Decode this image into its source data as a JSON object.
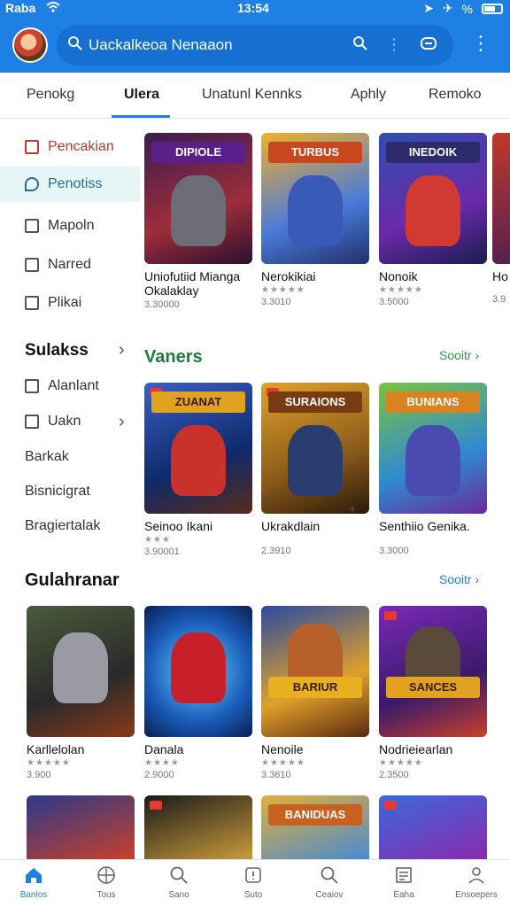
{
  "status": {
    "carrier": "Raba",
    "time": "13:54",
    "extra": "%"
  },
  "header": {
    "search_text": "Uackalkeoa Nenaaon",
    "brand": "#1f80e4"
  },
  "tabs": [
    {
      "label": "Penokg",
      "active": false
    },
    {
      "label": "Ulera",
      "active": true
    },
    {
      "label": "Unatunl Kennks",
      "active": false
    },
    {
      "label": "Aphly",
      "active": false
    },
    {
      "label": "Remoko",
      "active": false
    }
  ],
  "sidebar": {
    "items": [
      {
        "label": "Pencakian",
        "icon": "grid-icon"
      },
      {
        "label": "Penotiss",
        "icon": "chat-icon"
      },
      {
        "label": "Mapoln",
        "icon": "map-icon"
      },
      {
        "label": "Narred",
        "icon": "folder-icon"
      },
      {
        "label": "Plikai",
        "icon": "apps-icon"
      }
    ],
    "section": "Sulakss",
    "subitems": [
      {
        "label": "Alanlant",
        "icon": "tag-icon"
      },
      {
        "label": "Uakn",
        "icon": "house-icon"
      }
    ],
    "texts": [
      "Barkak",
      "Bisnicigrat",
      "Bragiertalak"
    ]
  },
  "row1": {
    "cards": [
      {
        "title": "Uniofutiid Mianga Okalaklay",
        "stars": "★★★★★",
        "meta": "3.30000",
        "art_title": "DIPIOLE"
      },
      {
        "title": "Nerokikiai",
        "stars": "★★★★★",
        "meta": "3.3010",
        "art_title": "TURBUS"
      },
      {
        "title": "Nonoik",
        "stars": "★★★★★",
        "meta": "3.5000",
        "art_title": "INEDOIK"
      },
      {
        "title": "Ho",
        "stars": "",
        "meta": "3.9",
        "art_title": ""
      }
    ]
  },
  "vaners": {
    "title": "Vaners",
    "see_all": "Sooitr ›",
    "cards": [
      {
        "title": "Seinoo Ikani",
        "stars": "★★★",
        "meta": "3.90001",
        "art_title": "ZUANAT"
      },
      {
        "title": "Ukrakdlain",
        "stars": "",
        "meta": "2.3910",
        "art_title": "SURAIONS"
      },
      {
        "title": "Senthiio Genika.",
        "stars": "",
        "meta": "3.3000",
        "art_title": "BUNIANS"
      }
    ]
  },
  "gulahranar": {
    "title": "Gulahranar",
    "see_all": "Sooitr ›",
    "cards": [
      {
        "title": "Karllelolan",
        "stars": "★★★★★",
        "meta": "3.900",
        "art_title": ""
      },
      {
        "title": "Danala",
        "stars": "★★★★",
        "meta": "2.9000",
        "art_title": ""
      },
      {
        "title": "Nenoile",
        "stars": "★★★★★",
        "meta": "3.3610",
        "art_title": "BARIUR"
      },
      {
        "title": "Nodrieiearlan",
        "stars": "★★★★★",
        "meta": "2.3500",
        "art_title": "SANCES"
      }
    ]
  },
  "row4": {
    "cards": [
      {
        "art_title": ""
      },
      {
        "art_title": ""
      },
      {
        "art_title": "BANIDUAS"
      },
      {
        "art_title": ""
      }
    ]
  },
  "bottom_nav": [
    {
      "label": "Banlos",
      "icon": "home-icon",
      "active": true
    },
    {
      "label": "Tous",
      "icon": "globe-icon",
      "active": false
    },
    {
      "label": "Sano",
      "icon": "search-icon",
      "active": false
    },
    {
      "label": "Suto",
      "icon": "info-icon",
      "active": false
    },
    {
      "label": "Ceaiov",
      "icon": "search2-icon",
      "active": false
    },
    {
      "label": "Eaha",
      "icon": "news-icon",
      "active": false
    },
    {
      "label": "Ensoepers",
      "icon": "person-icon",
      "active": false
    }
  ]
}
